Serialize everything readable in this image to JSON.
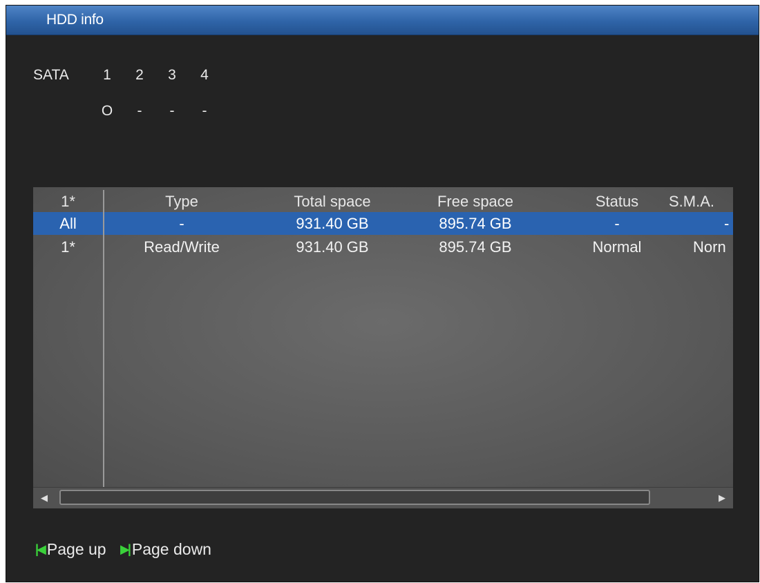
{
  "window": {
    "title": "HDD info"
  },
  "sata": {
    "label": "SATA",
    "ports": [
      "1",
      "2",
      "3",
      "4"
    ],
    "states": [
      "O",
      "-",
      "-",
      "-"
    ]
  },
  "table": {
    "columns": [
      "1*",
      "Type",
      "Total space",
      "Free space",
      "Status",
      "S.M.A."
    ],
    "rows": [
      {
        "id": "All",
        "type": "-",
        "total": "931.40 GB",
        "free": "895.74 GB",
        "status": "-",
        "smart": "-"
      },
      {
        "id": "1*",
        "type": "Read/Write",
        "total": "931.40 GB",
        "free": "895.74 GB",
        "status": "Normal",
        "smart": "Norn"
      }
    ]
  },
  "scrollbar": {
    "left_icon": "arrow-left-icon",
    "right_icon": "arrow-right-icon"
  },
  "footer": {
    "page_up_label": "Page up",
    "page_down_label": "Page down",
    "page_up_icon": "page-up-icon",
    "page_down_icon": "page-down-icon"
  },
  "colors": {
    "title_bar": "#2f64a8",
    "selected_row": "#2a63b0",
    "background": "#232323",
    "nav_icon": "#3ad13a"
  }
}
